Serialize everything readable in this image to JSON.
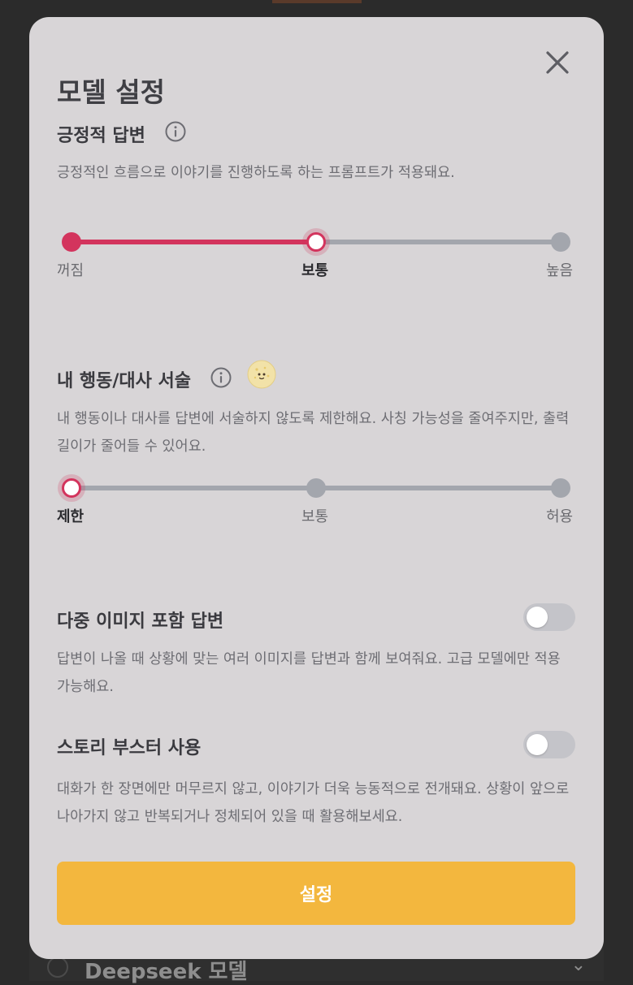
{
  "background": {
    "peek_label": "Deepseek 모델"
  },
  "modal": {
    "title": "모델 설정",
    "close_icon": "close-icon",
    "positive": {
      "title": "긍정적 답변",
      "description": "긍정적인 흐름으로 이야기를 진행하도록 하는 프롬프트가 적용돼요.",
      "options": [
        "꺼짐",
        "보통",
        "높음"
      ],
      "selected_index": 1,
      "selected": "보통"
    },
    "narration": {
      "title": "내 행동/대사 서술",
      "description": "내 행동이나 대사를 답변에 서술하지 않도록 제한해요. 사칭 가능성을 줄여주지만, 출력 길이가 줄어들 수 있어요.",
      "options": [
        "제한",
        "보통",
        "허용"
      ],
      "selected_index": 0,
      "selected": "제한"
    },
    "multi_image": {
      "title": "다중 이미지 포함 답변",
      "description": "답변이 나올 때 상황에 맞는 여러 이미지를 답변과 함께 보여줘요. 고급 모델에만 적용 가능해요.",
      "enabled": false
    },
    "story_booster": {
      "title": "스토리 부스터 사용",
      "description": "대화가 한 장면에만 머무르지 않고, 이야기가 더욱 능동적으로 전개돼요. 상황이 앞으로 나아가지 않고 반복되거나 정체되어 있을 때 활용해보세요.",
      "enabled": false
    },
    "submit_label": "설정"
  },
  "colors": {
    "accent": "#d3345d",
    "button": "#f3b73e",
    "modal_bg": "#d8d5d7",
    "inactive": "#a3a6ad"
  }
}
